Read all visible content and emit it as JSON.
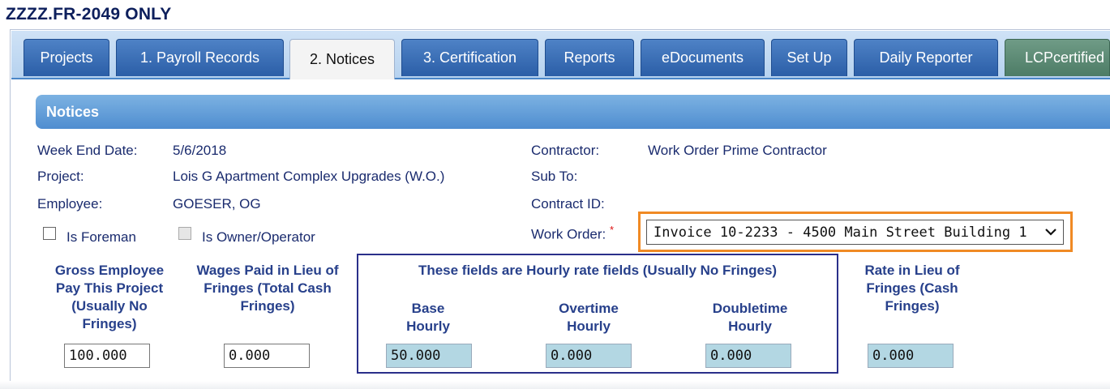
{
  "page_title": "ZZZZ.FR-2049 ONLY",
  "tabs": [
    {
      "label": "Projects",
      "active": false
    },
    {
      "label": "1. Payroll Records",
      "active": false
    },
    {
      "label": "2. Notices",
      "active": true
    },
    {
      "label": "3. Certification",
      "active": false
    },
    {
      "label": "Reports",
      "active": false
    },
    {
      "label": "eDocuments",
      "active": false
    },
    {
      "label": "Set Up",
      "active": false
    },
    {
      "label": "Daily Reporter",
      "active": false
    },
    {
      "label": "LCPcertified",
      "active": false
    }
  ],
  "section_title": "Notices",
  "info": {
    "week_end_date_label": "Week End Date:",
    "week_end_date_value": "5/6/2018",
    "project_label": "Project:",
    "project_value": "Lois G Apartment Complex Upgrades (W.O.)",
    "employee_label": "Employee:",
    "employee_value": "GOESER, OG",
    "contractor_label": "Contractor:",
    "contractor_value": "Work Order Prime Contractor",
    "sub_to_label": "Sub To:",
    "contract_id_label": "Contract ID:",
    "work_order_label": "Work Order:",
    "required_mark": "*",
    "work_order_value": "Invoice 10-2233 - 4500 Main Street Building 1"
  },
  "checkboxes": {
    "is_foreman_label": "Is Foreman",
    "is_foreman_checked": false,
    "is_owner_operator_label": "Is Owner/Operator",
    "is_owner_operator_checked": false,
    "is_owner_operator_disabled": true
  },
  "pay_fields": {
    "gross_pay_label": "Gross Employee Pay This Project (Usually No Fringes)",
    "gross_pay_value": "100.000",
    "wages_in_lieu_label": "Wages Paid in Lieu of Fringes (Total Cash Fringes)",
    "wages_in_lieu_value": "0.000",
    "hourly_group_title": "These fields are Hourly rate fields (Usually No Fringes)",
    "base_hourly_label": "Base Hourly",
    "base_hourly_value": "50.000",
    "overtime_hourly_label": "Overtime Hourly",
    "overtime_hourly_value": "0.000",
    "doubletime_hourly_label": "Doubletime Hourly",
    "doubletime_hourly_value": "0.000",
    "rate_in_lieu_label": "Rate in Lieu of Fringes (Cash Fringes)",
    "rate_in_lieu_value": "0.000"
  },
  "colors": {
    "tab_blue": "#2b5ea7",
    "tab_green": "#4d7c66",
    "header_blue": "#4f8dd0",
    "highlight_orange": "#f08a24",
    "label_navy": "#1a2b6e",
    "hourly_field_bg": "#b3d7e3"
  },
  "icons": {
    "select_arrow": "chevron-down-icon"
  }
}
